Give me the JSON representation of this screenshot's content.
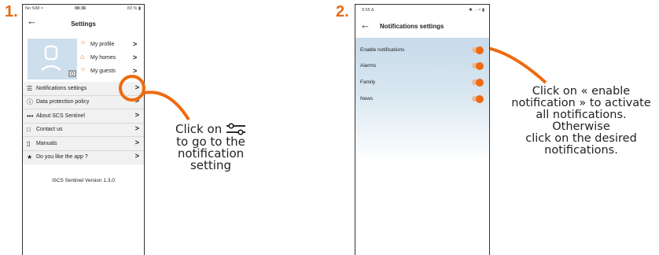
{
  "steps": {
    "one": "1.",
    "two": "2."
  },
  "phone1": {
    "status_left": "No SIM ≈",
    "status_time": "08:36",
    "status_right": "83 % ▮",
    "back_glyph": "←",
    "title": "Settings",
    "profile_links": [
      {
        "label": "My profile",
        "icon": "person-icon"
      },
      {
        "label": "My homes",
        "icon": "house-icon"
      },
      {
        "label": "My guests",
        "icon": "people-icon"
      }
    ],
    "menu": [
      {
        "label": "Notifications settings",
        "icon": "sliders-icon"
      },
      {
        "label": "Data protection policy",
        "icon": "info-icon"
      },
      {
        "label": "About SCS Sentinel",
        "icon": "dots-icon"
      },
      {
        "label": "Contact us",
        "icon": "chat-icon"
      },
      {
        "label": "Manuals",
        "icon": "document-icon"
      },
      {
        "label": "Do you like the app ?",
        "icon": "star-icon"
      }
    ],
    "version": "iSCS Sentinel Version 1.3.0",
    "chevron": ">"
  },
  "caption1": {
    "line1": "Click on",
    "line2": "to go to the",
    "line3": "notification",
    "line4": "setting"
  },
  "phone2": {
    "status_time": "9:55 Δ",
    "status_right": "✱ .∙∙ ≈ ▮",
    "back_glyph": "←",
    "title": "Notifications settings",
    "items": [
      {
        "label": "Enable notifications"
      },
      {
        "label": "Alarms"
      },
      {
        "label": "Family"
      },
      {
        "label": "News"
      }
    ]
  },
  "caption2": {
    "line1": "Click on « enable",
    "line2": "notification » to activate",
    "line3": "all notifications. Otherwise",
    "line4": "click on the desired",
    "line5": "notifications."
  },
  "colors": {
    "accent": "#ef6a10",
    "highlight": "#cddeed",
    "toggle_track": "#e8b998"
  }
}
